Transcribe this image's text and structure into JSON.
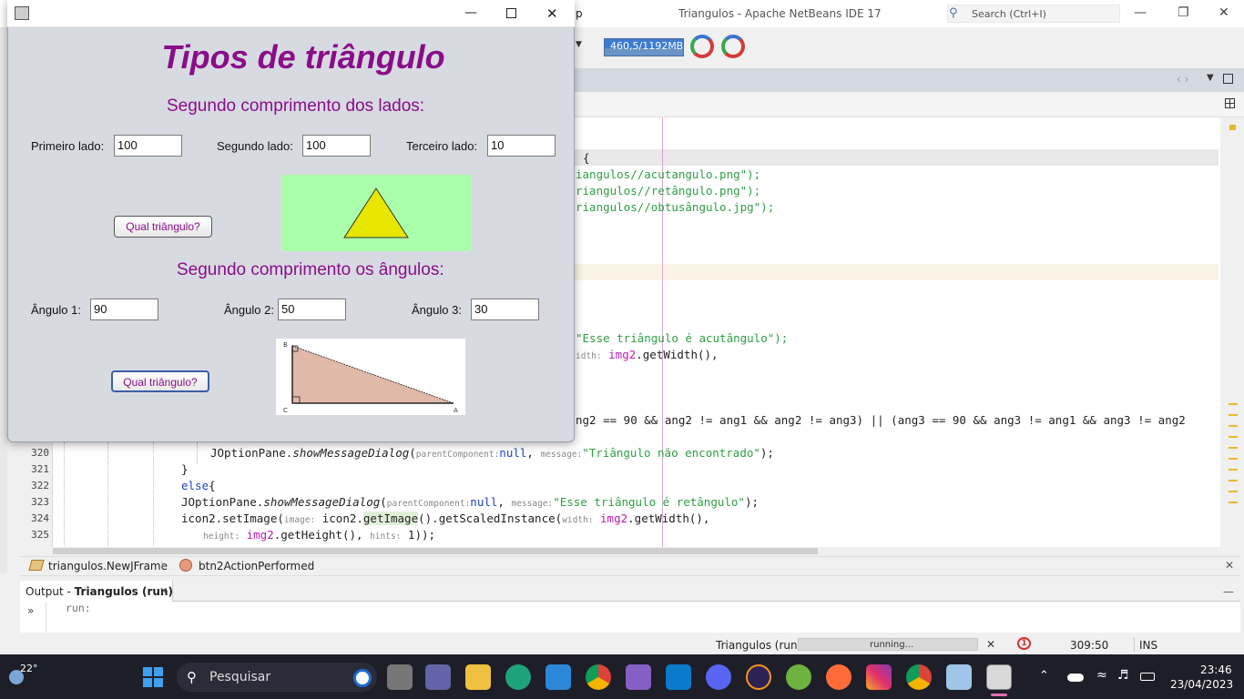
{
  "netbeans": {
    "window_title": "Triangulos - Apache NetBeans IDE 17",
    "menu_fragment": "p",
    "search_placeholder": "Search (Ctrl+I)",
    "memory": "460,5/1192MB",
    "line_numbers": [
      "320",
      "321",
      "322",
      "323",
      "324",
      "325"
    ],
    "breadcrumb": [
      "triangulos.NewJFrame",
      "btn2ActionPerformed"
    ],
    "output_tab_prefix": "Output - ",
    "output_tab_title": "Triangulos (run)",
    "output_text": "run:",
    "status": {
      "project": "Triangulos (run)",
      "progress": "running...",
      "notifications": "1",
      "position": "309:50",
      "mode": "INS"
    }
  },
  "code_lines": {
    "l174": "{",
    "l191": "iangulos//acutangulo.png\");",
    "l209": "riangulos//retângulo.png\");",
    "l227": "riangulos//obtusângulo.jpg\");",
    "l371": "\"Esse triângulo é acutângulo\");",
    "l389_hint": "idth:",
    "l389_var": "img2",
    "l389_rest": ".getWidth(),",
    "l461": "ng2 == 90 && ang2 != ang1 && ang2 != ang3) || (ang3 == 90 && ang3 != ang1 && ang3 != ang2",
    "l497_call": "JOptionPane.",
    "l497_method": "showMessageDialog",
    "l497_hint1": "parentComponent:",
    "l497_null": "null",
    "l497_hint2": "message:",
    "l497_str": "\"Triângulo não encontrado\"",
    "l497_end": ");",
    "l515": "}",
    "l533_kw": "else",
    "l533_brace": "{",
    "l551_call": "JOptionPane.",
    "l551_method": "showMessageDialog",
    "l551_hint1": "parentComponent:",
    "l551_null": "null",
    "l551_hint2": "message:",
    "l551_str": "\"Esse triângulo é retângulo\"",
    "l551_end": ");",
    "l569_a": "icon2.setImage(",
    "l569_hint1": "image:",
    "l569_b": " icon2.",
    "l569_c": "getImage",
    "l569_d": "().getScaledInstance(",
    "l569_hint2": "width:",
    "l569_var": "img2",
    "l569_e": ".getWidth(),",
    "l587_hint1": "height:",
    "l587_var": "img2",
    "l587_a": ".getHeight(),",
    "l587_hint2": "hints:",
    "l587_b": " 1));"
  },
  "dialog": {
    "title": "Tipos de triângulo",
    "section1": "Segundo comprimento dos lados:",
    "side1_label": "Primeiro lado:",
    "side1_value": "100",
    "side2_label": "Segundo lado:",
    "side2_value": "100",
    "side3_label": "Terceiro lado:",
    "side3_value": "10",
    "button1": "Qual triângulo?",
    "section2": "Segundo comprimento os ângulos:",
    "angle1_label": "Ângulo 1:",
    "angle1_value": "90",
    "angle2_label": "Ângulo 2:",
    "angle2_value": "50",
    "angle3_label": "Ângulo 3:",
    "angle3_value": "30",
    "button2": "Qual triângulo?",
    "right_triangle_labels": [
      "B",
      "C",
      "A"
    ]
  },
  "taskbar": {
    "temperature": "22°",
    "search": "Pesquisar",
    "time": "23:46",
    "date": "23/04/2023"
  },
  "colors": {
    "title_purple": "#8a0d8a",
    "triangle_yellow": "#e6e600",
    "image_green": "#aaffaa",
    "right_triangle_fill": "#e0b9a8"
  }
}
